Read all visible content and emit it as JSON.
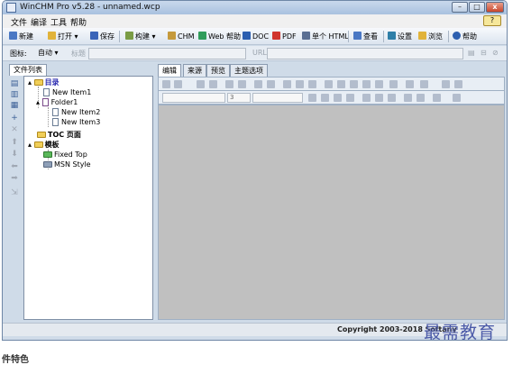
{
  "window": {
    "title": "WinCHM Pro v5.28 - unnamed.wcp",
    "min_symbol": "–",
    "max_symbol": "□",
    "close_symbol": "x"
  },
  "menu": [
    "文件",
    "编译",
    "工具",
    "帮助"
  ],
  "toolbar": [
    {
      "label": "新建",
      "icon": "new-page-icon",
      "color": "#4a78c4"
    },
    {
      "label": "打开",
      "icon": "folder-open-icon",
      "color": "#e1b33a"
    },
    {
      "label": "保存",
      "icon": "save-disk-icon",
      "color": "#3a64b8"
    },
    {
      "label": "构建",
      "icon": "build-icon",
      "color": "#7a9c45"
    },
    {
      "label": "CHM",
      "icon": "chm-icon",
      "color": "#c59a3c"
    },
    {
      "label": "Web 帮助",
      "icon": "web-help-icon",
      "color": "#2f9c5a"
    },
    {
      "label": "DOC",
      "icon": "doc-icon",
      "color": "#2c5fb0"
    },
    {
      "label": "PDF",
      "icon": "pdf-icon",
      "color": "#d0342c"
    },
    {
      "label": "单个 HTML",
      "icon": "single-html-icon",
      "color": "#5a6f93"
    },
    {
      "label": "查看",
      "icon": "view-icon",
      "color": "#4a78c4"
    },
    {
      "label": "设置",
      "icon": "settings-icon",
      "color": "#2f7fa8"
    },
    {
      "label": "浏览",
      "icon": "browse-icon",
      "color": "#e1b33a"
    },
    {
      "label": "帮助",
      "icon": "help-icon",
      "color": "#2c5fb0"
    }
  ],
  "props": {
    "icon_label": "图标:",
    "icon_value": "自动",
    "title_label": "标题",
    "url_label": "URL"
  },
  "left_tab": "文件列表",
  "tree": [
    {
      "label": "目录",
      "type": "folder",
      "bold": true,
      "color": "#2c2cb0"
    },
    {
      "label": "New Item1",
      "type": "page"
    },
    {
      "label": "Folder1",
      "type": "page"
    },
    {
      "label": "New Item2",
      "type": "page"
    },
    {
      "label": "New Item3",
      "type": "page"
    },
    {
      "label": "TOC 页面",
      "type": "folder",
      "bold": true
    },
    {
      "label": "模板",
      "type": "folder",
      "bold": true
    },
    {
      "label": "Fixed Top",
      "type": "template"
    },
    {
      "label": "MSN Style",
      "type": "template"
    }
  ],
  "editor_tabs": [
    "编辑",
    "来源",
    "预览",
    "主题选项"
  ],
  "editor_combos": {
    "font": "",
    "size": "3"
  },
  "status": {
    "copyright": "Copyright 2003-2018 Softany"
  },
  "watermark": "最需教育",
  "below_text": "件特色"
}
